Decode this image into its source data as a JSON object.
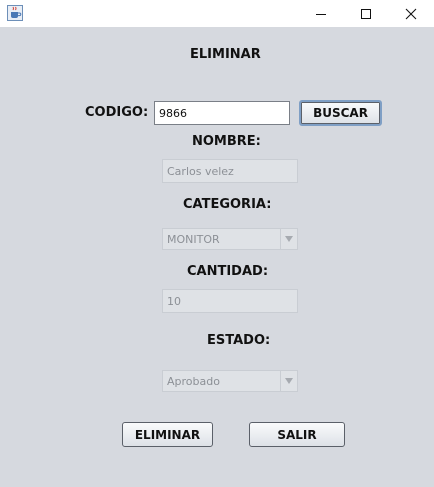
{
  "window": {
    "icons": {
      "app": "java-cup-icon",
      "minimize": "minimize-icon",
      "maximize": "maximize-icon",
      "close": "close-icon"
    }
  },
  "form": {
    "title": "ELIMINAR",
    "codigo_label": "CODIGO:",
    "codigo_value": "9866",
    "buscar_label": "BUSCAR",
    "nombre_label": "NOMBRE:",
    "nombre_value": "Carlos velez",
    "categoria_label": "CATEGORIA:",
    "categoria_value": "MONITOR",
    "cantidad_label": "CANTIDAD:",
    "cantidad_value": "10",
    "estado_label": "ESTADO:",
    "estado_value": "Aprobado",
    "eliminar_label": "ELIMINAR",
    "salir_label": "SALIR"
  },
  "colors": {
    "background": "#d6d9df",
    "disabled_text": "#8c9096",
    "focus_border": "#7f9fc5"
  }
}
